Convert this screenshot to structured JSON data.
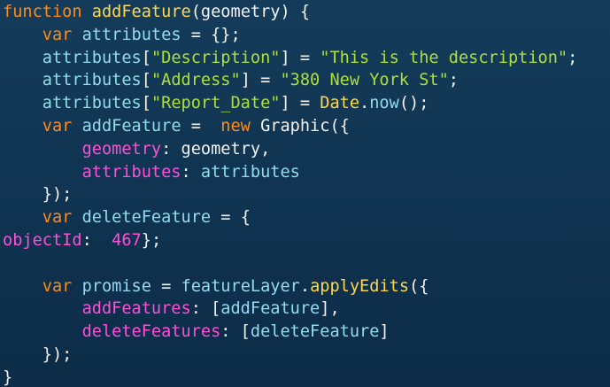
{
  "editor": {
    "background": "#10344f",
    "colors": {
      "keyword": "#ff8c1a",
      "function": "#ffd84d",
      "identifier": "#93dcef",
      "string": "#aee03a",
      "property": "#ff4fd8",
      "punctuation": "#f2f2f2",
      "number": "#ff4fd8",
      "builtin_class": "#ffd84d",
      "method": "#93dcef"
    },
    "lines": [
      [
        {
          "t": "function",
          "c": "keyword"
        },
        {
          "t": " ",
          "c": "punctuation"
        },
        {
          "t": "addFeature",
          "c": "function"
        },
        {
          "t": "(geometry) {",
          "c": "punctuation"
        }
      ],
      [
        {
          "t": "    ",
          "c": "punctuation"
        },
        {
          "t": "var",
          "c": "keyword"
        },
        {
          "t": " attributes",
          "c": "identifier"
        },
        {
          "t": " = {};",
          "c": "punctuation"
        }
      ],
      [
        {
          "t": "    ",
          "c": "punctuation"
        },
        {
          "t": "attributes",
          "c": "identifier"
        },
        {
          "t": "[",
          "c": "punctuation"
        },
        {
          "t": "\"Description\"",
          "c": "string"
        },
        {
          "t": "] = ",
          "c": "punctuation"
        },
        {
          "t": "\"This is the description\"",
          "c": "string"
        },
        {
          "t": ";",
          "c": "punctuation"
        }
      ],
      [
        {
          "t": "    ",
          "c": "punctuation"
        },
        {
          "t": "attributes",
          "c": "identifier"
        },
        {
          "t": "[",
          "c": "punctuation"
        },
        {
          "t": "\"Address\"",
          "c": "string"
        },
        {
          "t": "] = ",
          "c": "punctuation"
        },
        {
          "t": "\"380 New York St\"",
          "c": "string"
        },
        {
          "t": ";",
          "c": "punctuation"
        }
      ],
      [
        {
          "t": "    ",
          "c": "punctuation"
        },
        {
          "t": "attributes",
          "c": "identifier"
        },
        {
          "t": "[",
          "c": "punctuation"
        },
        {
          "t": "\"Report_Date\"",
          "c": "string"
        },
        {
          "t": "] = ",
          "c": "punctuation"
        },
        {
          "t": "Date",
          "c": "builtin_class"
        },
        {
          "t": ".",
          "c": "punctuation"
        },
        {
          "t": "now",
          "c": "method"
        },
        {
          "t": "();",
          "c": "punctuation"
        }
      ],
      [
        {
          "t": "    ",
          "c": "punctuation"
        },
        {
          "t": "var",
          "c": "keyword"
        },
        {
          "t": " addFeature",
          "c": "identifier"
        },
        {
          "t": " =  ",
          "c": "punctuation"
        },
        {
          "t": "new",
          "c": "keyword"
        },
        {
          "t": " Graphic({",
          "c": "punctuation"
        }
      ],
      [
        {
          "t": "        ",
          "c": "punctuation"
        },
        {
          "t": "geometry",
          "c": "property"
        },
        {
          "t": ": geometry,",
          "c": "punctuation"
        }
      ],
      [
        {
          "t": "        ",
          "c": "punctuation"
        },
        {
          "t": "attributes",
          "c": "property"
        },
        {
          "t": ": ",
          "c": "punctuation"
        },
        {
          "t": "attributes",
          "c": "identifier"
        }
      ],
      [
        {
          "t": "    });",
          "c": "punctuation"
        }
      ],
      [
        {
          "t": "    ",
          "c": "punctuation"
        },
        {
          "t": "var",
          "c": "keyword"
        },
        {
          "t": " deleteFeature",
          "c": "identifier"
        },
        {
          "t": " = {",
          "c": "punctuation"
        }
      ],
      [
        {
          "t": "objectId",
          "c": "property"
        },
        {
          "t": ":  ",
          "c": "punctuation"
        },
        {
          "t": "467",
          "c": "number"
        },
        {
          "t": "};",
          "c": "punctuation"
        }
      ],
      [
        {
          "t": " ",
          "c": "punctuation"
        }
      ],
      [
        {
          "t": "    ",
          "c": "punctuation"
        },
        {
          "t": "var",
          "c": "keyword"
        },
        {
          "t": " promise",
          "c": "identifier"
        },
        {
          "t": " = ",
          "c": "punctuation"
        },
        {
          "t": "featureLayer",
          "c": "identifier"
        },
        {
          "t": ".",
          "c": "punctuation"
        },
        {
          "t": "applyEdits",
          "c": "function"
        },
        {
          "t": "({",
          "c": "punctuation"
        }
      ],
      [
        {
          "t": "        ",
          "c": "punctuation"
        },
        {
          "t": "addFeatures",
          "c": "property"
        },
        {
          "t": ": [",
          "c": "punctuation"
        },
        {
          "t": "addFeature",
          "c": "identifier"
        },
        {
          "t": "],",
          "c": "punctuation"
        }
      ],
      [
        {
          "t": "        ",
          "c": "punctuation"
        },
        {
          "t": "deleteFeatures",
          "c": "property"
        },
        {
          "t": ": [",
          "c": "punctuation"
        },
        {
          "t": "deleteFeature",
          "c": "identifier"
        },
        {
          "t": "]",
          "c": "punctuation"
        }
      ],
      [
        {
          "t": "    });",
          "c": "punctuation"
        }
      ],
      [
        {
          "t": "}",
          "c": "punctuation"
        }
      ]
    ]
  }
}
